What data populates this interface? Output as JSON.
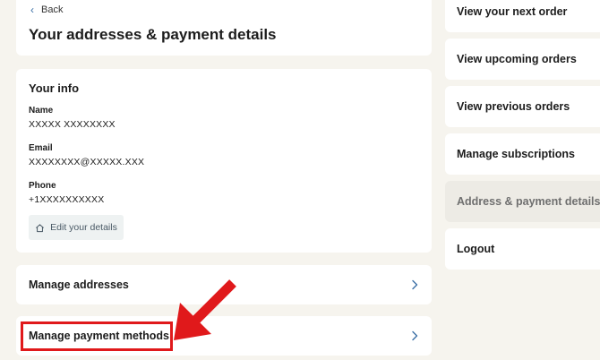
{
  "header": {
    "back_label": "Back",
    "title": "Your addresses & payment details"
  },
  "info": {
    "title": "Your info",
    "name_label": "Name",
    "name_value": "XXXXX XXXXXXXX",
    "email_label": "Email",
    "email_value": "XXXXXXXX@XXXXX.XXX",
    "phone_label": "Phone",
    "phone_value": "+1XXXXXXXXXX",
    "edit_label": "Edit your details"
  },
  "manage": {
    "addresses_label": "Manage addresses",
    "payment_label": "Manage payment methods"
  },
  "nav": {
    "items": [
      {
        "label": "View your next order"
      },
      {
        "label": "View upcoming orders"
      },
      {
        "label": "View previous orders"
      },
      {
        "label": "Manage subscriptions"
      },
      {
        "label": "Address & payment details"
      },
      {
        "label": "Logout"
      }
    ],
    "active_index": 4
  },
  "colors": {
    "background": "#f6f4ee",
    "card": "#ffffff",
    "annotation_red": "#e0191b",
    "link_blue": "#3a6ea5"
  },
  "icons": [
    "chevron-left-icon",
    "home-icon",
    "chevron-right-icon",
    "red-arrow-icon"
  ]
}
